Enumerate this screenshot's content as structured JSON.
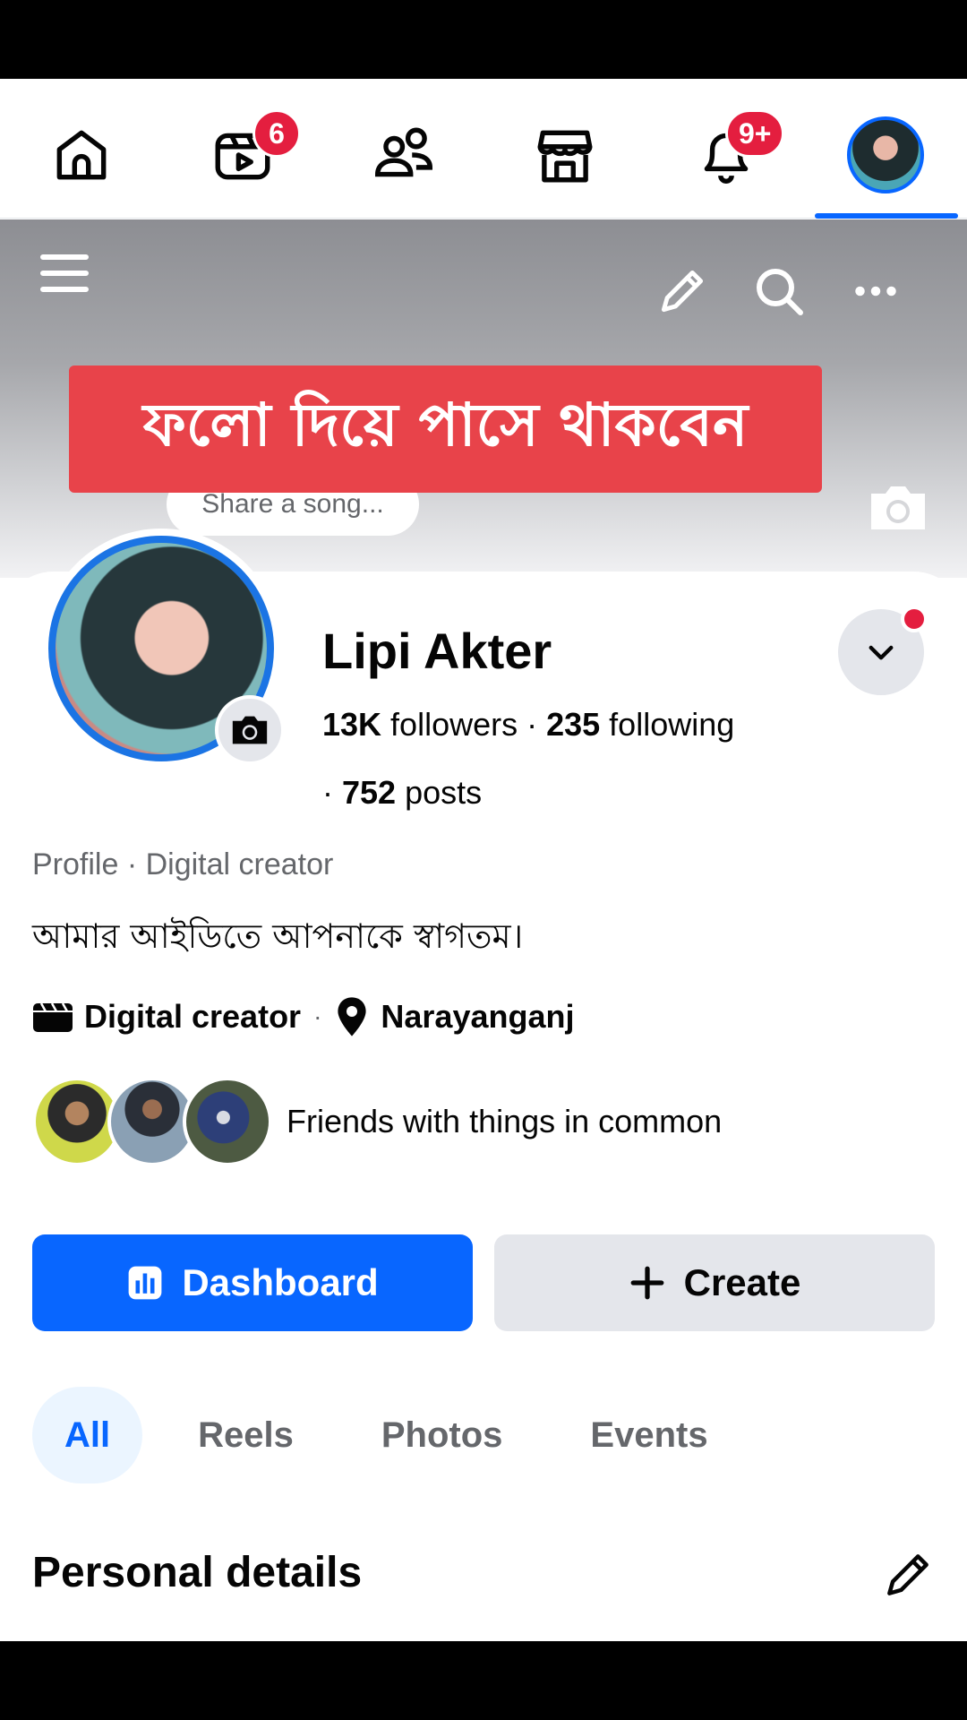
{
  "nav": {
    "items": [
      {
        "name": "home",
        "badge": ""
      },
      {
        "name": "video",
        "badge": "6"
      },
      {
        "name": "friends",
        "badge": ""
      },
      {
        "name": "marketplace",
        "badge": ""
      },
      {
        "name": "notifications",
        "badge": "9+"
      },
      {
        "name": "profile",
        "badge": ""
      }
    ],
    "video_badge": "6",
    "notifications_badge": "9+"
  },
  "cover": {
    "overlay_text": "ফলো দিয়ে পাসে থাকবেন",
    "song_prompt": "Share a song..."
  },
  "profile": {
    "name": "Lipi Akter",
    "followers_count": "13K",
    "followers_label": " followers · ",
    "following_count": "235",
    "following_label": " following",
    "posts_prefix": "· ",
    "posts_count": "752",
    "posts_label": " posts",
    "category": "Profile · Digital creator",
    "bio": "আমার আইডিতে আপনাকে স্বাগতম।",
    "creator_label": "Digital creator",
    "location": "Narayanganj",
    "friends_text": "Friends with things in common"
  },
  "actions": {
    "dashboard_label": "Dashboard",
    "create_label": "Create"
  },
  "tabs": [
    "All",
    "Reels",
    "Photos",
    "Events"
  ],
  "section": {
    "personal_details": "Personal details"
  },
  "colors": {
    "accent": "#0866ff",
    "badge": "#e41e3f",
    "banner": "#e8434a"
  }
}
